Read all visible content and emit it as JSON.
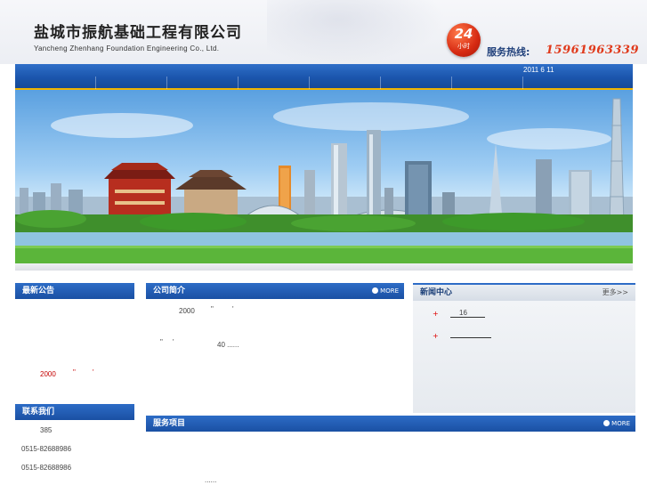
{
  "header": {
    "company_cn": "盐城市振航基础工程有限公司",
    "company_en": "Yancheng Zhenhang Foundation Engineering Co., Ltd.",
    "badge_number": "24",
    "badge_sub": "小时",
    "hotline_label": "服务热线:",
    "hotline_number": "15961963339"
  },
  "nav": {
    "date": "2011 6 11"
  },
  "left": {
    "notice_title": "最新公告",
    "notice_text": "2000",
    "notice_quote": "\"",
    "notice_mark": "'",
    "contact_title": "联系我们",
    "contact_lines": [
      "385",
      "0515-82688986",
      "0515-82688986"
    ]
  },
  "about": {
    "title": "公司简介",
    "more": "MORE",
    "line1_year": "2000",
    "line1_q": "\"",
    "line1_m": "'",
    "line2_q": "\"",
    "line2_m": "'",
    "line2_tail": "40 ......"
  },
  "news": {
    "title": "新闻中心",
    "more": "更多>>",
    "items": [
      "16",
      ""
    ]
  },
  "services": {
    "title": "服务项目",
    "more": "MORE",
    "bottom_text": "......"
  },
  "colors": {
    "brand_blue": "#1b56ad",
    "accent_red": "#e03a1c",
    "gold": "#f0b400"
  }
}
